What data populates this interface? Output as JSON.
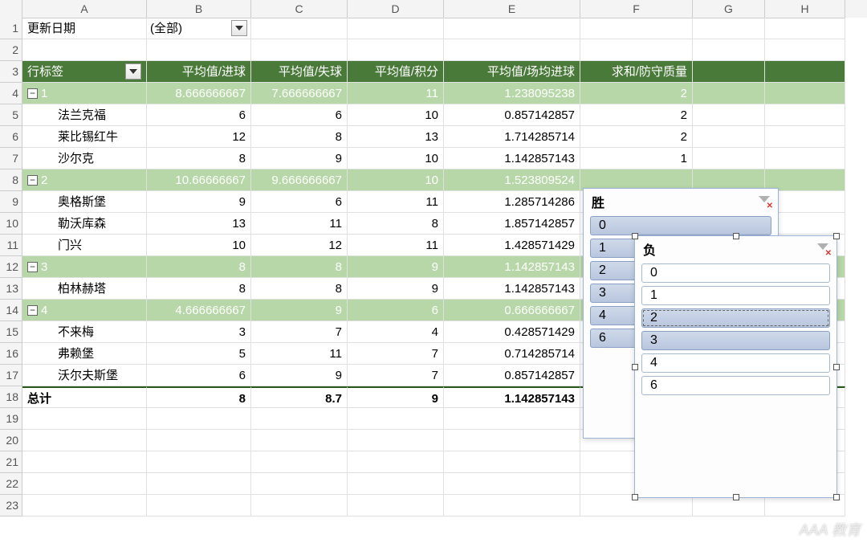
{
  "columns": [
    "A",
    "B",
    "C",
    "D",
    "E",
    "F",
    "G",
    "H"
  ],
  "row1": {
    "a": "更新日期",
    "filter_value": "(全部)"
  },
  "pivot": {
    "label_header": "行标签",
    "measures": [
      "平均值/进球",
      "平均值/失球",
      "平均值/积分",
      "平均值/场均进球",
      "求和/防守质量"
    ],
    "groups": [
      {
        "id": "g1",
        "label": "1",
        "vals": [
          "8.666666667",
          "7.666666667",
          "11",
          "1.238095238",
          "2"
        ],
        "rows": [
          {
            "name": "法兰克福",
            "vals": [
              "6",
              "6",
              "10",
              "0.857142857",
              "2"
            ]
          },
          {
            "name": "莱比锡红牛",
            "vals": [
              "12",
              "8",
              "13",
              "1.714285714",
              "2"
            ]
          },
          {
            "name": "沙尔克",
            "vals": [
              "8",
              "9",
              "10",
              "1.142857143",
              "1"
            ]
          }
        ]
      },
      {
        "id": "g2",
        "label": "2",
        "vals": [
          "10.66666667",
          "9.666666667",
          "10",
          "1.523809524",
          ""
        ],
        "rows": [
          {
            "name": "奥格斯堡",
            "vals": [
              "9",
              "6",
              "11",
              "1.285714286",
              ""
            ]
          },
          {
            "name": "勒沃库森",
            "vals": [
              "13",
              "11",
              "8",
              "1.857142857",
              ""
            ]
          },
          {
            "name": "门兴",
            "vals": [
              "10",
              "12",
              "11",
              "1.428571429",
              ""
            ]
          }
        ]
      },
      {
        "id": "g3",
        "label": "3",
        "vals": [
          "8",
          "8",
          "9",
          "1.142857143",
          ""
        ],
        "rows": [
          {
            "name": "柏林赫塔",
            "vals": [
              "8",
              "8",
              "9",
              "1.142857143",
              ""
            ]
          }
        ]
      },
      {
        "id": "g4",
        "label": "4",
        "vals": [
          "4.666666667",
          "9",
          "6",
          "0.666666667",
          ""
        ],
        "rows": [
          {
            "name": "不来梅",
            "vals": [
              "3",
              "7",
              "4",
              "0.428571429",
              ""
            ]
          },
          {
            "name": "弗赖堡",
            "vals": [
              "5",
              "11",
              "7",
              "0.714285714",
              ""
            ]
          },
          {
            "name": "沃尔夫斯堡",
            "vals": [
              "6",
              "9",
              "7",
              "0.857142857",
              ""
            ]
          }
        ]
      }
    ],
    "grand_total": {
      "label": "总计",
      "vals": [
        "8",
        "8.7",
        "9",
        "1.142857143",
        ""
      ]
    }
  },
  "slicers": {
    "sheng": {
      "title": "胜",
      "items": [
        {
          "label": "0",
          "selected": true
        },
        {
          "label": "1",
          "selected": true
        },
        {
          "label": "2",
          "selected": true
        },
        {
          "label": "3",
          "selected": true
        },
        {
          "label": "4",
          "selected": true
        },
        {
          "label": "6",
          "selected": true
        }
      ]
    },
    "fu": {
      "title": "负",
      "items": [
        {
          "label": "0",
          "selected": false
        },
        {
          "label": "1",
          "selected": false
        },
        {
          "label": "2",
          "selected": true,
          "focus": true
        },
        {
          "label": "3",
          "selected": true
        },
        {
          "label": "4",
          "selected": false
        },
        {
          "label": "6",
          "selected": false
        }
      ]
    }
  },
  "collapse_glyph": "−",
  "watermark": "AAA 教育"
}
